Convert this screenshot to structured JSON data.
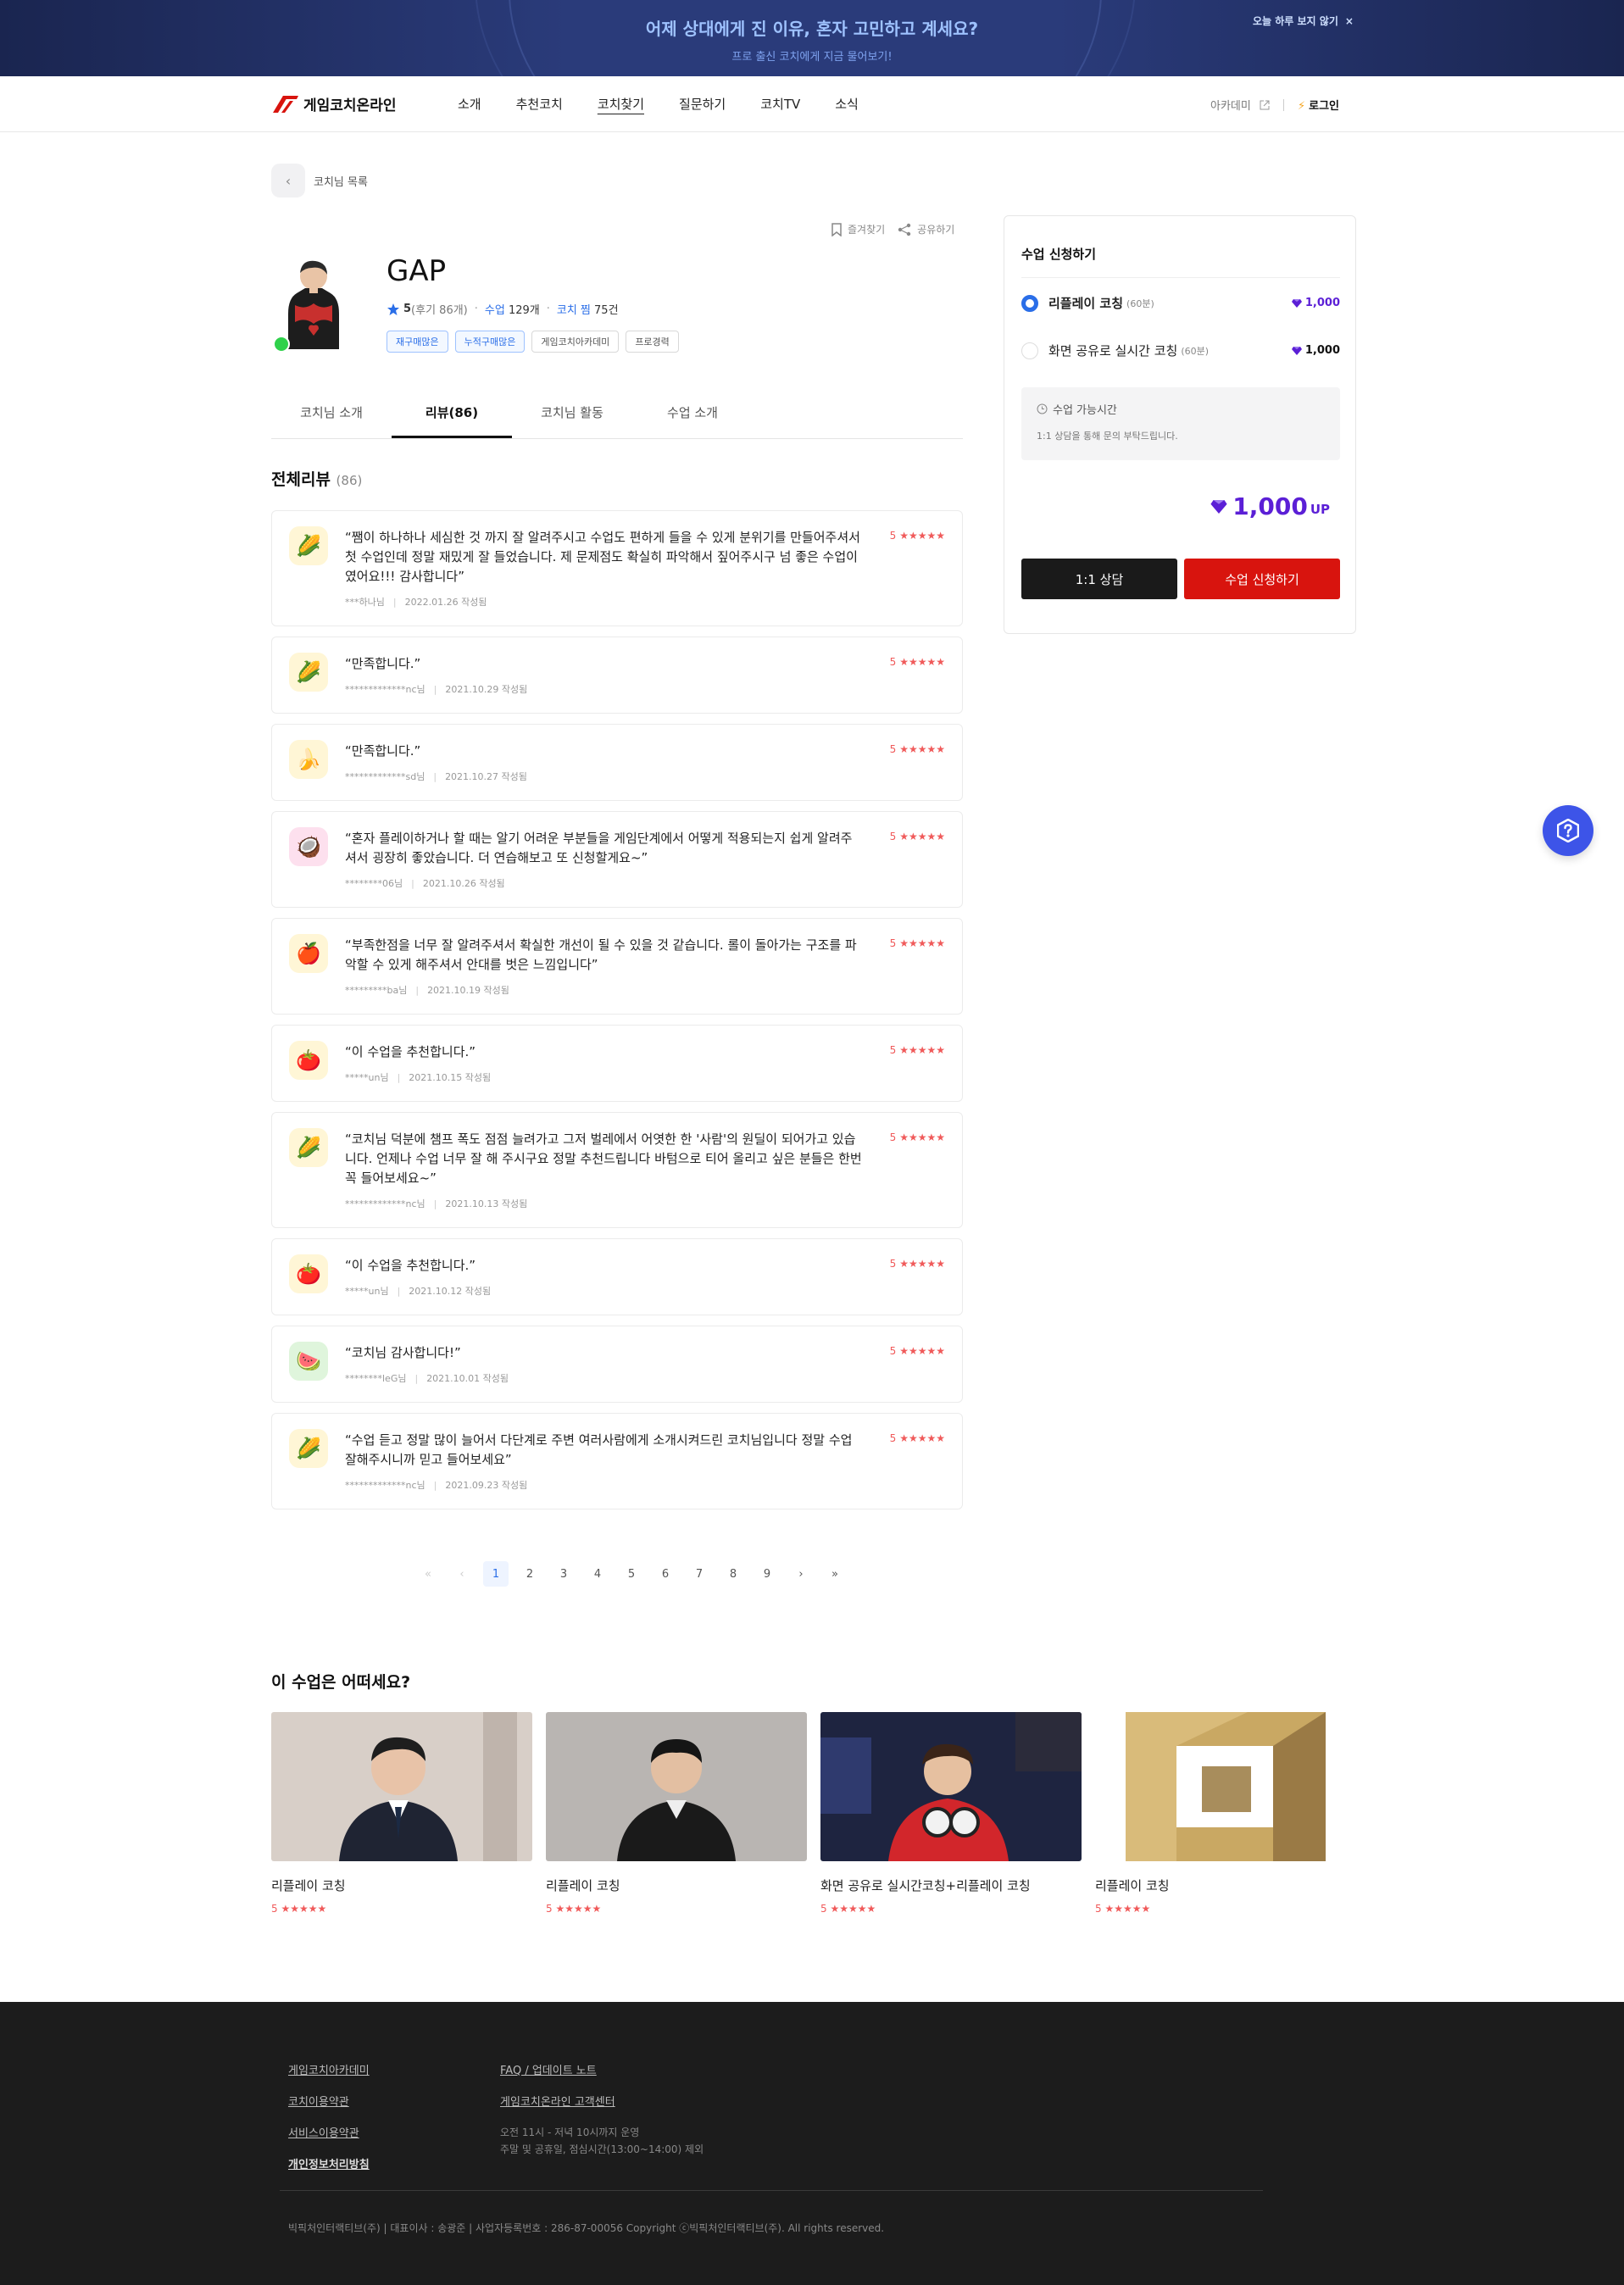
{
  "banner": {
    "title": "어제 상대에게 진 이유, 혼자 고민하고 계세요?",
    "subtitle": "프로 출신 코치에게 지금 물어보기!",
    "close_label": "오늘 하루 보지 않기",
    "close_icon": "×"
  },
  "header": {
    "logo_text": "게임코치온라인",
    "nav": [
      "소개",
      "추천코치",
      "코치찾기",
      "질문하기",
      "코치TV",
      "소식"
    ],
    "academy": "아카데미",
    "login": "로그인",
    "login_icon": "⚡"
  },
  "back": {
    "label": "코치님 목록",
    "icon": "‹"
  },
  "profile": {
    "bookmark": "즐겨찾기",
    "share": "공유하기",
    "name": "GAP",
    "rating": "5",
    "review_count": "(후기 86개)",
    "class_label": "수업",
    "class_count": "129개",
    "pick_label": "코치 찜",
    "pick_count": "75건",
    "tags": [
      "재구매많은",
      "누적구매많은",
      "게임코치아카데미",
      "프로경력"
    ]
  },
  "tabs": [
    "코치님 소개",
    "리뷰(86)",
    "코치님 활동",
    "수업 소개"
  ],
  "reviews": {
    "title": "전체리뷰",
    "count": "(86)",
    "items": [
      {
        "text": "“쨈이 하나하나 세심한 것 까지 잘 알려주시고 수업도 편하게 들을 수 있게 분위기를 만들어주셔서 첫 수업인데 정말 재밌게 잘 들었습니다. 제 문제점도 확실히 파악해서 짚어주시구 넘 좋은 수업이였어요!!! 감사합니다”",
        "user": "***하나님",
        "date": "2022.01.26 작성됨",
        "score": "5",
        "stars": "★★★★★",
        "icon": "🌽"
      },
      {
        "text": "“만족합니다.”",
        "user": "*************nc님",
        "date": "2021.10.29 작성됨",
        "score": "5",
        "stars": "★★★★★",
        "icon": "🌽"
      },
      {
        "text": "“만족합니다.”",
        "user": "*************sd님",
        "date": "2021.10.27 작성됨",
        "score": "5",
        "stars": "★★★★★",
        "icon": "🍌"
      },
      {
        "text": "“혼자 플레이하거나 할 때는 알기 어려운 부분들을 게임단계에서 어떻게 적용되는지 쉽게 알려주셔서 굉장히 좋았습니다. 더 연습해보고 또 신청할게요~”",
        "user": "********06님",
        "date": "2021.10.26 작성됨",
        "score": "5",
        "stars": "★★★★★",
        "icon": "🥥"
      },
      {
        "text": "“부족한점을 너무 잘 알려주셔서 확실한 개선이 될 수 있을 것 같습니다. 롤이 돌아가는 구조를 파악할 수 있게 해주셔서 안대를 벗은 느낌입니다”",
        "user": "*********ba님",
        "date": "2021.10.19 작성됨",
        "score": "5",
        "stars": "★★★★★",
        "icon": "🍎"
      },
      {
        "text": "“이 수업을 추천합니다.”",
        "user": "*****un님",
        "date": "2021.10.15 작성됨",
        "score": "5",
        "stars": "★★★★★",
        "icon": "🍅"
      },
      {
        "text": "“코치님 덕분에 챔프 폭도 점점 늘려가고 그저 벌레에서 어엿한 한 '사람'의 원딜이 되어가고 있습니다. 언제나 수업 너무 잘 해 주시구요 정말 추천드립니다 바텀으로 티어 올리고 싶은 분들은 한번 꼭 들어보세요~”",
        "user": "*************nc님",
        "date": "2021.10.13 작성됨",
        "score": "5",
        "stars": "★★★★★",
        "icon": "🌽"
      },
      {
        "text": "“이 수업을 추천합니다.”",
        "user": "*****un님",
        "date": "2021.10.12 작성됨",
        "score": "5",
        "stars": "★★★★★",
        "icon": "🍅"
      },
      {
        "text": "“코치님 감사합니다!”",
        "user": "********leG님",
        "date": "2021.10.01 작성됨",
        "score": "5",
        "stars": "★★★★★",
        "icon": "🍉"
      },
      {
        "text": "“수업 듣고 정말 많이 늘어서 다단계로 주변 여러사람에게 소개시켜드린 코치님입니다 정말 수업 잘해주시니까 믿고 들어보세요”",
        "user": "*************nc님",
        "date": "2021.09.23 작성됨",
        "score": "5",
        "stars": "★★★★★",
        "icon": "🌽"
      }
    ]
  },
  "pagination": {
    "first": "«",
    "prev": "‹",
    "pages": [
      "1",
      "2",
      "3",
      "4",
      "5",
      "6",
      "7",
      "8",
      "9"
    ],
    "next": "›",
    "last": "»",
    "current": "1"
  },
  "recommend": {
    "title": "이 수업은 어떠세요?",
    "items": [
      {
        "name": "리플레이 코칭",
        "score": "5",
        "stars": "★★★★★"
      },
      {
        "name": "리플레이 코칭",
        "score": "5",
        "stars": "★★★★★"
      },
      {
        "name": "화면 공유로 실시간코칭+리플레이 코칭",
        "score": "5",
        "stars": "★★★★★"
      },
      {
        "name": "리플레이 코칭",
        "score": "5",
        "stars": "★★★★★"
      }
    ]
  },
  "sidebar": {
    "title": "수업 신청하기",
    "options": [
      {
        "label": "리플레이 코칭",
        "duration": "(60분)",
        "price": "1,000",
        "selected": true
      },
      {
        "label": "화면 공유로 실시간 코칭",
        "duration": "(60분)",
        "price": "1,000",
        "selected": false
      }
    ],
    "avail_title": "수업 가능시간",
    "avail_desc": "1:1 상담을 통해 문의 부탁드립니다.",
    "total": "1,000",
    "unit": "UP",
    "consult_btn": "1:1 상담",
    "apply_btn": "수업 신청하기"
  },
  "footer": {
    "col1": [
      "게임코치아카데미",
      "코치이용약관",
      "서비스이용약관",
      "개인정보처리방침"
    ],
    "col2": [
      "FAQ / 업데이트 노트",
      "게임코치온라인 고객센터"
    ],
    "hours1": "오전 11시 - 저녁 10시까지 운영",
    "hours2": "주말 및 공휴일, 점심시간(13:00~14:00) 제외",
    "copyright": "빅픽처인터랙티브(주)  |  대표이사 : 송광준  |  사업자등록번호 : 286-87-00056 Copyright ⓒ빅픽처인터랙티브(주). All rights reserved."
  },
  "colors": {
    "accent": "#2a6ee8",
    "cta": "#d8140e",
    "star": "#f05a5a",
    "up": "#5b1fd6",
    "banner_bg": "#1f2c5e",
    "footer_bg": "#1c1c1c"
  }
}
